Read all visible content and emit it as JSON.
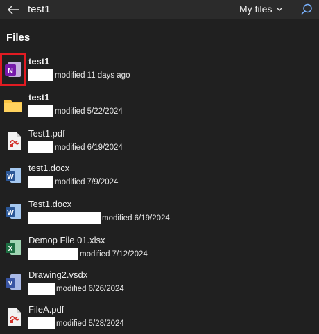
{
  "search": {
    "query": "test1",
    "scope_label": "My files"
  },
  "section": {
    "title": "Files"
  },
  "files": [
    {
      "name": "test1",
      "modified": "modified 11 days ago",
      "type": "onenote",
      "bold": true
    },
    {
      "name": "test1",
      "modified": "modified 5/22/2024",
      "type": "folder",
      "bold": true
    },
    {
      "name": "Test1.pdf",
      "modified": "modified 6/19/2024",
      "type": "pdf",
      "bold": false
    },
    {
      "name": "test1.docx",
      "modified": "modified 7/9/2024",
      "type": "word",
      "bold": false
    },
    {
      "name": "Test1.docx",
      "modified": "modified 6/19/2024",
      "type": "word",
      "bold": false
    },
    {
      "name": "Demop File 01.xlsx",
      "modified": "modified 7/12/2024",
      "type": "excel",
      "bold": false
    },
    {
      "name": "Drawing2.vsdx",
      "modified": "modified 6/26/2024",
      "type": "visio",
      "bold": false
    },
    {
      "name": "FileA.pdf",
      "modified": "modified 5/28/2024",
      "type": "pdf",
      "bold": false
    }
  ],
  "colors": {
    "background": "#202020",
    "topbar": "#2b2b2b",
    "highlight": "#e11b22",
    "onenote": "#7719aa",
    "folder": "#f8c243",
    "pdf": "#d2312a",
    "word": "#2b5797",
    "excel": "#1d6f42",
    "visio": "#3955a3"
  }
}
